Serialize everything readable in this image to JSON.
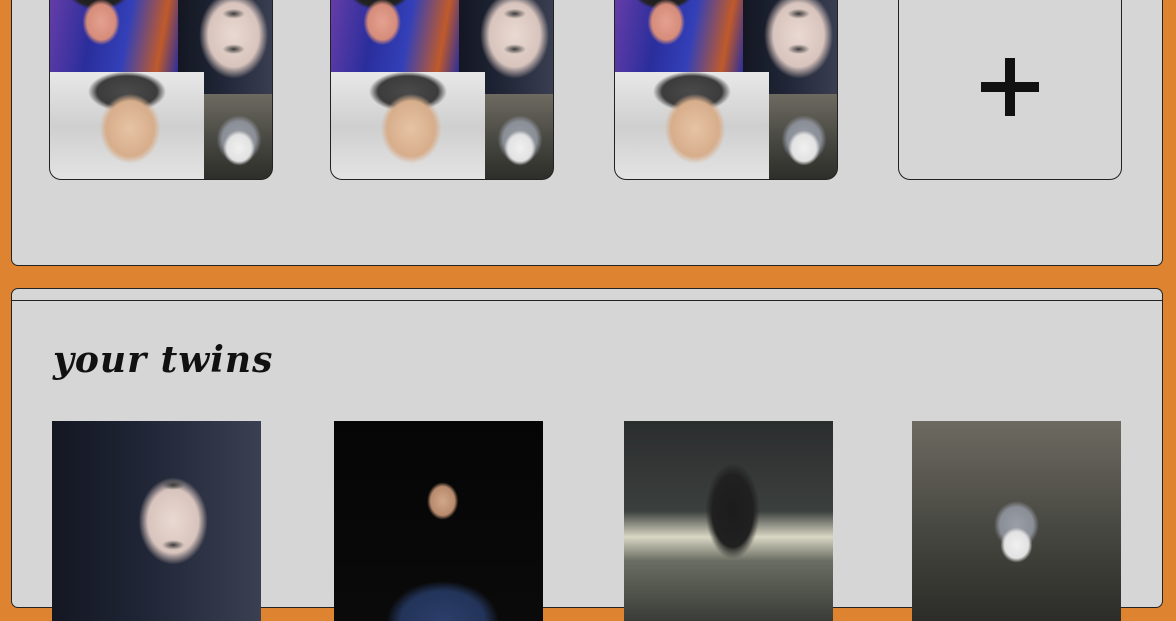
{
  "groups": {
    "tiles": [
      {
        "name": "group-1"
      },
      {
        "name": "group-2"
      },
      {
        "name": "group-3"
      }
    ],
    "add_icon": "plus-icon"
  },
  "twins": {
    "title": "your twins",
    "photos": [
      {
        "name": "twin-photo-1"
      },
      {
        "name": "twin-photo-2"
      },
      {
        "name": "twin-photo-3"
      },
      {
        "name": "twin-photo-4"
      }
    ]
  },
  "colors": {
    "background": "#DE8430",
    "panel": "#D6D6D6",
    "border": "#222222"
  }
}
